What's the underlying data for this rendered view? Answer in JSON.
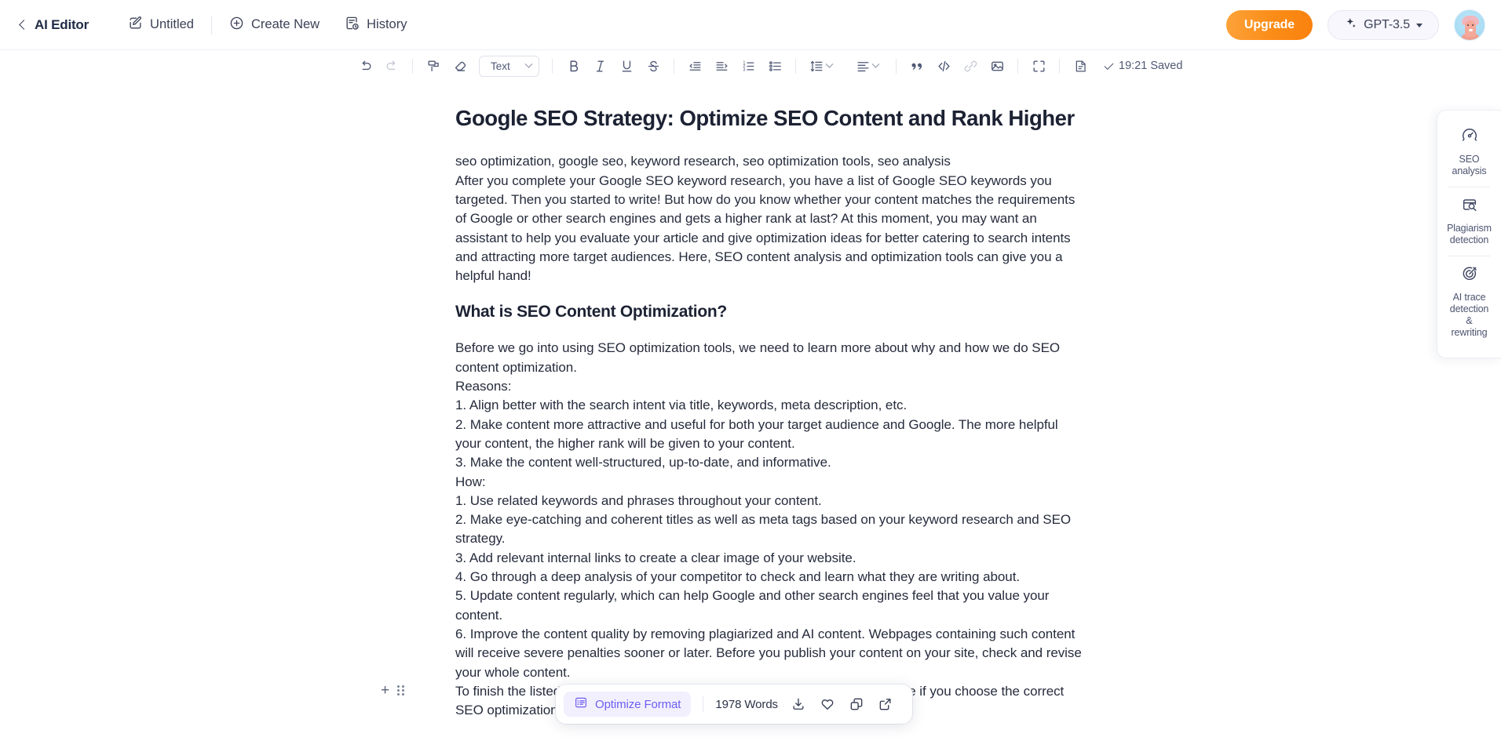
{
  "header": {
    "back_icon": "chevron-left-icon",
    "app_title": "AI Editor",
    "doc_name": "Untitled",
    "doc_name_icon": "edit-square-icon",
    "create_new": "Create New",
    "create_new_icon": "plus-circle-icon",
    "history": "History",
    "history_icon": "document-clock-icon",
    "upgrade_label": "Upgrade",
    "model_label": "GPT-3.5",
    "model_icon": "sparkles-icon",
    "avatar_icon": "user-avatar",
    "accent_orange": "#fb8c17",
    "accent_purple": "#6d5ef0"
  },
  "toolbar": {
    "undo": "undo-icon",
    "redo": "redo-icon",
    "format_paint": "format-paint-icon",
    "clear_format": "eraser-icon",
    "style_value": "Text",
    "bold": "B",
    "italic": "I",
    "underline": "U",
    "strike": "S",
    "outdent": "outdent-icon",
    "indent": "indent-icon",
    "ordered_list": "numbered-list-icon",
    "bullet_list": "bulleted-list-icon",
    "line_height": "line-height-icon",
    "align": "align-icon",
    "quote": "quote-icon",
    "code": "code-icon",
    "link": "link-icon",
    "image": "image-icon",
    "fullscreen": "fullscreen-icon",
    "page": "page-icon",
    "saved_text": "19:21 Saved"
  },
  "document": {
    "title": "Google SEO Strategy: Optimize SEO Content and Rank Higher",
    "keywords": "seo optimization, google seo, keyword research, seo optimization tools, seo analysis",
    "intro": "After you complete your Google SEO keyword research, you have a list of Google SEO keywords you targeted. Then you started to write! But how do you know whether your content matches the requirements of Google or other search engines and gets a higher rank at last? At this moment, you may want an assistant to help you evaluate your article and give optimization ideas for better catering to search intents and attracting more target audiences. Here, SEO content analysis and optimization tools can give you a helpful hand!",
    "heading2": "What is SEO Content Optimization?",
    "body_before": "Before we go into using SEO optimization tools, we need to learn more about why and how we do SEO content optimization.",
    "reasons_label": "Reasons:",
    "reason_1": "1. Align better with the search intent via title, keywords, meta description, etc.",
    "reason_2": "2. Make content more attractive and useful for both your target audience and Google. The more helpful your content, the higher rank will be given to your content.",
    "reason_3": "3. Make the content well-structured, up-to-date, and informative.",
    "how_label": "How:",
    "how_1": "1. Use related keywords and phrases throughout your content.",
    "how_2": "2. Make eye-catching and coherent titles as well as meta tags based on your keyword research and SEO strategy.",
    "how_3": "3. Add relevant internal links to create a clear image of your website.",
    "how_4": "4. Go through a deep analysis of your competitor to check and learn what they are writing about.",
    "how_5": "5. Update content regularly, which can help Google and other search engines feel that you value your content.",
    "how_6": "6. Improve the content quality by removing plagiarized and AI content. Webpages containing such content will receive severe penalties sooner or later. Before you publish your content on your site, check and revise your whole content.",
    "closing": "To finish the listed tasks above, it may only take you less than an hour to make if you choose the correct SEO optimization tool to help you.",
    "block_add_icon": "plus-icon",
    "block_drag_icon": "drag-handle-icon"
  },
  "right_panel": {
    "items": [
      {
        "icon": "speedometer-icon",
        "line1": "SEO",
        "line2": "analysis",
        "line3": ""
      },
      {
        "icon": "page-search-icon",
        "line1": "Plagiarism",
        "line2": "detection",
        "line3": ""
      },
      {
        "icon": "target-pen-icon",
        "line1": "AI trace",
        "line2": "detection",
        "line3": "&",
        "line4": "rewriting"
      }
    ]
  },
  "float_bar": {
    "optimize_icon": "list-panel-icon",
    "optimize_label": "Optimize Format",
    "word_count": "1978 Words",
    "download_icon": "download-icon",
    "favorite_icon": "heart-icon",
    "copy_icon": "copy-icon",
    "share_icon": "external-link-icon"
  }
}
